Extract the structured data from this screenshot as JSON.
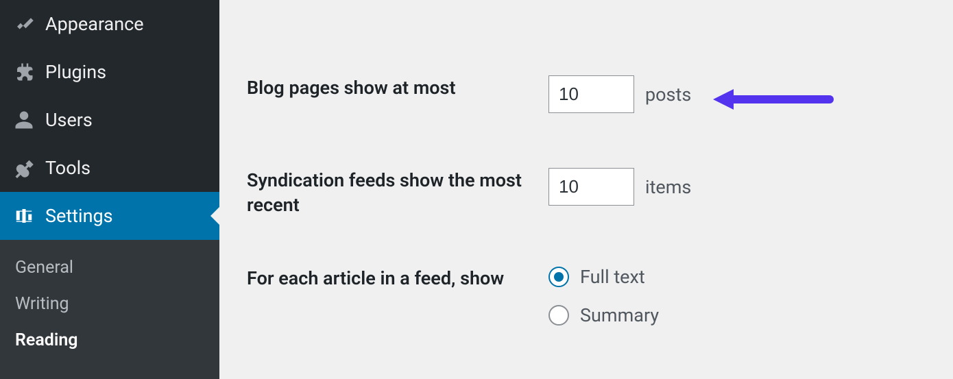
{
  "sidebar": {
    "items": [
      {
        "label": "Appearance",
        "icon": "appearance-icon"
      },
      {
        "label": "Plugins",
        "icon": "plugins-icon"
      },
      {
        "label": "Users",
        "icon": "users-icon"
      },
      {
        "label": "Tools",
        "icon": "tools-icon"
      },
      {
        "label": "Settings",
        "icon": "settings-icon",
        "active": true
      }
    ],
    "submenu": [
      {
        "label": "General"
      },
      {
        "label": "Writing"
      },
      {
        "label": "Reading",
        "current": true
      }
    ]
  },
  "settings": {
    "blog_pages": {
      "label": "Blog pages show at most",
      "value": "10",
      "unit": "posts"
    },
    "syndication": {
      "label": "Syndication feeds show the most recent",
      "value": "10",
      "unit": "items"
    },
    "feed_article": {
      "label": "For each article in a feed, show",
      "options": {
        "full_text": "Full text",
        "summary": "Summary"
      },
      "selected": "full_text"
    }
  }
}
